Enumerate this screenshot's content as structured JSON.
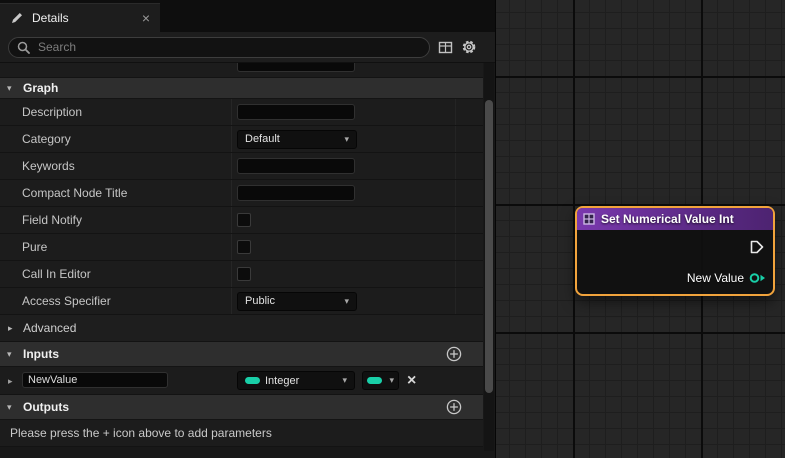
{
  "details": {
    "tab_title": "Details",
    "search_placeholder": "Search",
    "graph_section_title": "Graph",
    "graph_rows": [
      {
        "label": "Description",
        "control": "text"
      },
      {
        "label": "Category",
        "control": "combo",
        "value": "Default"
      },
      {
        "label": "Keywords",
        "control": "text"
      },
      {
        "label": "Compact Node Title",
        "control": "text"
      },
      {
        "label": "Field Notify",
        "control": "checkbox"
      },
      {
        "label": "Pure",
        "control": "checkbox"
      },
      {
        "label": "Call In Editor",
        "control": "checkbox"
      },
      {
        "label": "Access Specifier",
        "control": "combo",
        "value": "Public"
      }
    ],
    "advanced_label": "Advanced",
    "inputs_section_title": "Inputs",
    "input_param": {
      "name": "NewValue",
      "type": "Integer"
    },
    "outputs_section_title": "Outputs",
    "outputs_empty_hint": "Please press the + icon above to add parameters"
  },
  "graph": {
    "node": {
      "title": "Set Numerical Value Int",
      "output_pin_label": "New Value"
    }
  },
  "colors": {
    "selection-orange": "#F1A33C",
    "pin-teal": "#19CFA8",
    "node-header-purple": "#7A38AE"
  }
}
